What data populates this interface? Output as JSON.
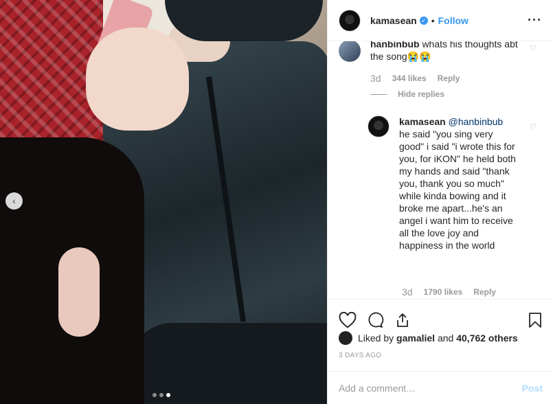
{
  "post": {
    "username": "kamasean",
    "verified_glyph": "✓",
    "separator": "•",
    "follow_label": "Follow",
    "more_label": "···"
  },
  "photo": {
    "prev_arrow": "‹",
    "carousel_total": 3,
    "carousel_active": 3
  },
  "comments": [
    {
      "username": "hanbinbub",
      "text": "whats his thoughts abt the song😭😭",
      "ago": "3d",
      "likes": "344 likes",
      "reply_label": "Reply"
    }
  ],
  "hide_replies_label": "Hide replies",
  "reply": {
    "username": "kamasean",
    "mention": "@hanbinbub",
    "text": "he said \"you sing very good\" i said \"i wrote this for you, for iKON\" he held both my hands and said \"thank you, thank you so much\" while kinda bowing and it broke me apart...he's an angel i want him to receive all the love joy and happiness in the world",
    "ago": "3d",
    "likes": "1790 likes",
    "reply_label": "Reply"
  },
  "likes": {
    "prefix": "Liked by",
    "first_liker": "gamaliel",
    "conj": "and",
    "others": "40,762 others"
  },
  "timestamp": "3 DAYS AGO",
  "add_comment": {
    "placeholder": "Add a comment…",
    "post_label": "Post"
  },
  "colors": {
    "accent": "#3897f0",
    "post_disabled": "#b2dffc",
    "muted": "#999999"
  }
}
